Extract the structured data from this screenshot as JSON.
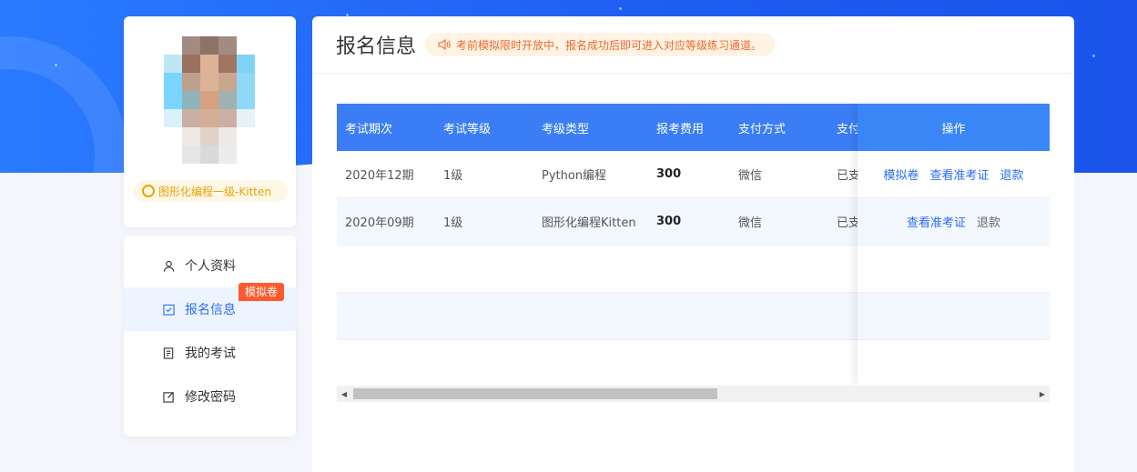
{
  "profile": {
    "badge_text": "图形化编程一级-Kitten",
    "avatar_pixels": [
      "#ffffff",
      "#a38b82",
      "#8d7366",
      "#a38b82",
      "#ffffff",
      "#bde6f5",
      "#9a705e",
      "#dcb396",
      "#a07562",
      "#7ed3f5",
      "#7ad6ff",
      "#bfa08d",
      "#dbb396",
      "#c9a68e",
      "#8ed9f8",
      "#7ad6ff",
      "#8fb3b9",
      "#d9a07f",
      "#9fb2b1",
      "#8ed9f8",
      "#d8f1fb",
      "#c9b0a3",
      "#d4ae95",
      "#cbb1a3",
      "#e7f2f6",
      "#ffffff",
      "#efe9e6",
      "#e0d2ca",
      "#efe9e6",
      "#ffffff",
      "#ffffff",
      "#e6e6e6",
      "#d9d9d9",
      "#ececec",
      "#ffffff"
    ]
  },
  "menu": {
    "items": [
      {
        "label": "个人资料"
      },
      {
        "label": "报名信息",
        "tag": "模拟卷"
      },
      {
        "label": "我的考试"
      },
      {
        "label": "修改密码"
      }
    ]
  },
  "header": {
    "title": "报名信息",
    "notice": "考前模拟限时开放中，报名成功后即可进入对应等级练习通道。"
  },
  "table": {
    "columns": [
      "考试期次",
      "考试等级",
      "考级类型",
      "报考费用",
      "支付方式",
      "支付"
    ],
    "op_header": "操作",
    "rows": [
      {
        "period": "2020年12期",
        "level": "1级",
        "type": "Python编程",
        "fee": "300",
        "pay_method": "微信",
        "pay_status": "已支",
        "ops": [
          {
            "label": "模拟卷",
            "style": "link"
          },
          {
            "label": "查看准考证",
            "style": "link"
          },
          {
            "label": "退款",
            "style": "link"
          }
        ]
      },
      {
        "period": "2020年09期",
        "level": "1级",
        "type": "图形化编程Kitten",
        "fee": "300",
        "pay_method": "微信",
        "pay_status": "已支",
        "ops": [
          {
            "label": "查看准考证",
            "style": "link"
          },
          {
            "label": "退款",
            "style": "muted"
          }
        ]
      }
    ]
  },
  "colors": {
    "primary": "#2a6ef5",
    "header_bg": "#3b7df5",
    "notice_text": "#f06a2a",
    "tag_bg": "#ff5a2e",
    "badge_text": "#e8a400"
  }
}
